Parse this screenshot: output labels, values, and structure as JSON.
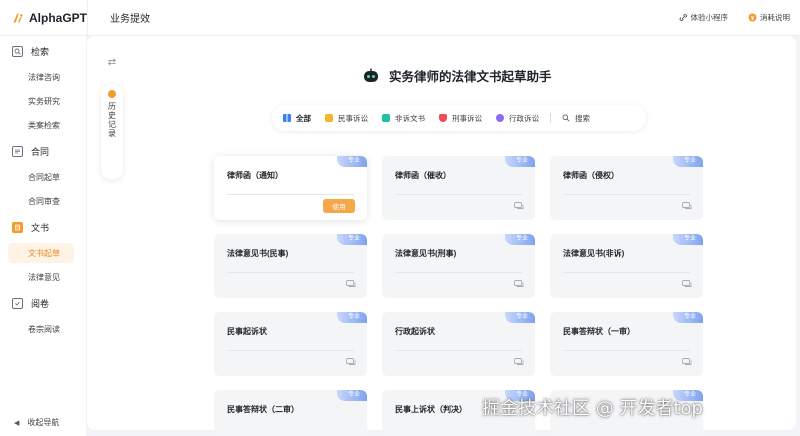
{
  "app": {
    "name": "AlphaGPT",
    "page_title": "业务提效"
  },
  "top_actions": {
    "mini_program": "体验小程序",
    "usage_notes": "消耗说明"
  },
  "sidebar": {
    "sections": [
      {
        "label": "检索",
        "items": [
          "法律咨询",
          "实务研究",
          "类案检索"
        ]
      },
      {
        "label": "合同",
        "items": [
          "合同起草",
          "合同审查"
        ]
      },
      {
        "label": "文书",
        "items": [
          "文书起草",
          "法律意见"
        ],
        "active_item": "文书起草"
      },
      {
        "label": "阅卷",
        "items": [
          "卷宗阅读"
        ]
      }
    ],
    "collapse": "收起导航"
  },
  "history_label": "历史记录",
  "headline": "实务律师的法律文书起草助手",
  "tabs": [
    {
      "label": "全部",
      "icon": "grid-icon",
      "active": true
    },
    {
      "label": "民事诉讼",
      "icon": "civil-icon"
    },
    {
      "label": "非诉文书",
      "icon": "non-litigation-icon"
    },
    {
      "label": "刑事诉讼",
      "icon": "criminal-icon"
    },
    {
      "label": "行政诉讼",
      "icon": "admin-icon"
    },
    {
      "label": "搜索",
      "icon": "search-icon"
    }
  ],
  "badge_label": "专业",
  "use_button_label": "使用",
  "cards": [
    {
      "title": "律师函（通知）",
      "highlight": true
    },
    {
      "title": "律师函（催收）"
    },
    {
      "title": "律师函（侵权）"
    },
    {
      "title": "法律意见书(民事)"
    },
    {
      "title": "法律意见书(刑事)"
    },
    {
      "title": "法律意见书(非诉)"
    },
    {
      "title": "民事起诉状"
    },
    {
      "title": "行政起诉状"
    },
    {
      "title": "民事答辩状（一审）"
    },
    {
      "title": "民事答辩状（二审）"
    },
    {
      "title": "民事上诉状（判决）"
    },
    {
      "title": ""
    }
  ],
  "colors": {
    "accent": "#f79a2c",
    "badge": "#7fa2ef",
    "active_bg": "#fff3e6"
  },
  "watermark": "掘金技术社区 @ 开发者top"
}
